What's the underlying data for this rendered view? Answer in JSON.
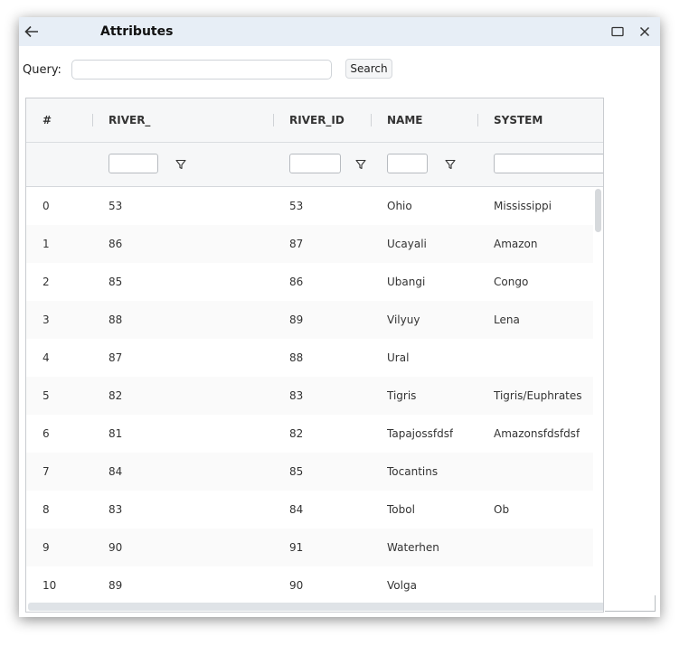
{
  "window": {
    "title": "Attributes"
  },
  "query": {
    "label": "Query:",
    "value": "",
    "placeholder": "",
    "search_label": "Search"
  },
  "table": {
    "columns": [
      {
        "key": "index",
        "label": "#"
      },
      {
        "key": "river_",
        "label": "RIVER_"
      },
      {
        "key": "river_id",
        "label": "RIVER_ID"
      },
      {
        "key": "name",
        "label": "NAME"
      },
      {
        "key": "system",
        "label": "SYSTEM"
      }
    ],
    "rows": [
      {
        "index": "0",
        "river_": "53",
        "river_id": "53",
        "name": "Ohio",
        "system": "Mississippi"
      },
      {
        "index": "1",
        "river_": "86",
        "river_id": "87",
        "name": "Ucayali",
        "system": "Amazon"
      },
      {
        "index": "2",
        "river_": "85",
        "river_id": "86",
        "name": "Ubangi",
        "system": "Congo"
      },
      {
        "index": "3",
        "river_": "88",
        "river_id": "89",
        "name": "Vilyuy",
        "system": "Lena"
      },
      {
        "index": "4",
        "river_": "87",
        "river_id": "88",
        "name": "Ural",
        "system": ""
      },
      {
        "index": "5",
        "river_": "82",
        "river_id": "83",
        "name": "Tigris",
        "system": "Tigris/Euphrates"
      },
      {
        "index": "6",
        "river_": "81",
        "river_id": "82",
        "name": "Tapajossfdsf",
        "system": "Amazonsfdsfdsf"
      },
      {
        "index": "7",
        "river_": "84",
        "river_id": "85",
        "name": "Tocantins",
        "system": ""
      },
      {
        "index": "8",
        "river_": "83",
        "river_id": "84",
        "name": "Tobol",
        "system": "Ob"
      },
      {
        "index": "9",
        "river_": "90",
        "river_id": "91",
        "name": "Waterhen",
        "system": ""
      },
      {
        "index": "10",
        "river_": "89",
        "river_id": "90",
        "name": "Volga",
        "system": ""
      }
    ]
  },
  "icons": {
    "back": "arrow-left-icon",
    "maximize": "maximize-icon",
    "close": "close-icon",
    "filter": "filter-icon"
  },
  "colors": {
    "titlebar": "#e7eef6",
    "header": "#f6f7f8",
    "border": "#c9ccd0"
  }
}
